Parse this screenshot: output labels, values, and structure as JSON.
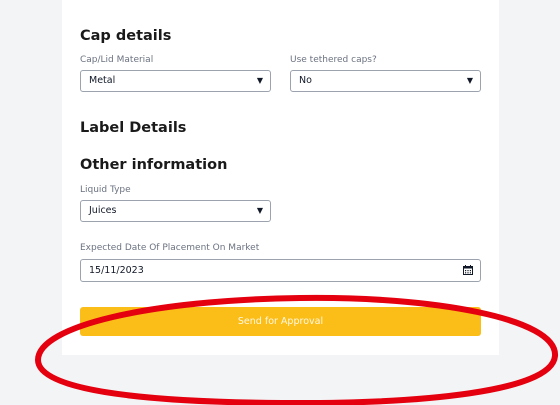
{
  "cap_details": {
    "title": "Cap details",
    "material_label": "Cap/Lid Material",
    "material_value": "Metal",
    "tethered_label": "Use tethered caps?",
    "tethered_value": "No"
  },
  "label_details": {
    "title": "Label Details"
  },
  "other_information": {
    "title": "Other information",
    "liquid_type_label": "Liquid Type",
    "liquid_type_value": "Juices",
    "date_label": "Expected Date Of Placement On Market",
    "date_value": "15/11/2023"
  },
  "actions": {
    "submit_label": "Send for Approval"
  },
  "colors": {
    "accent": "#fbbd18",
    "annotation": "#e4000f",
    "background": "#f3f4f6"
  },
  "icons": {
    "dropdown": "caret-down-icon",
    "calendar": "calendar-icon"
  }
}
